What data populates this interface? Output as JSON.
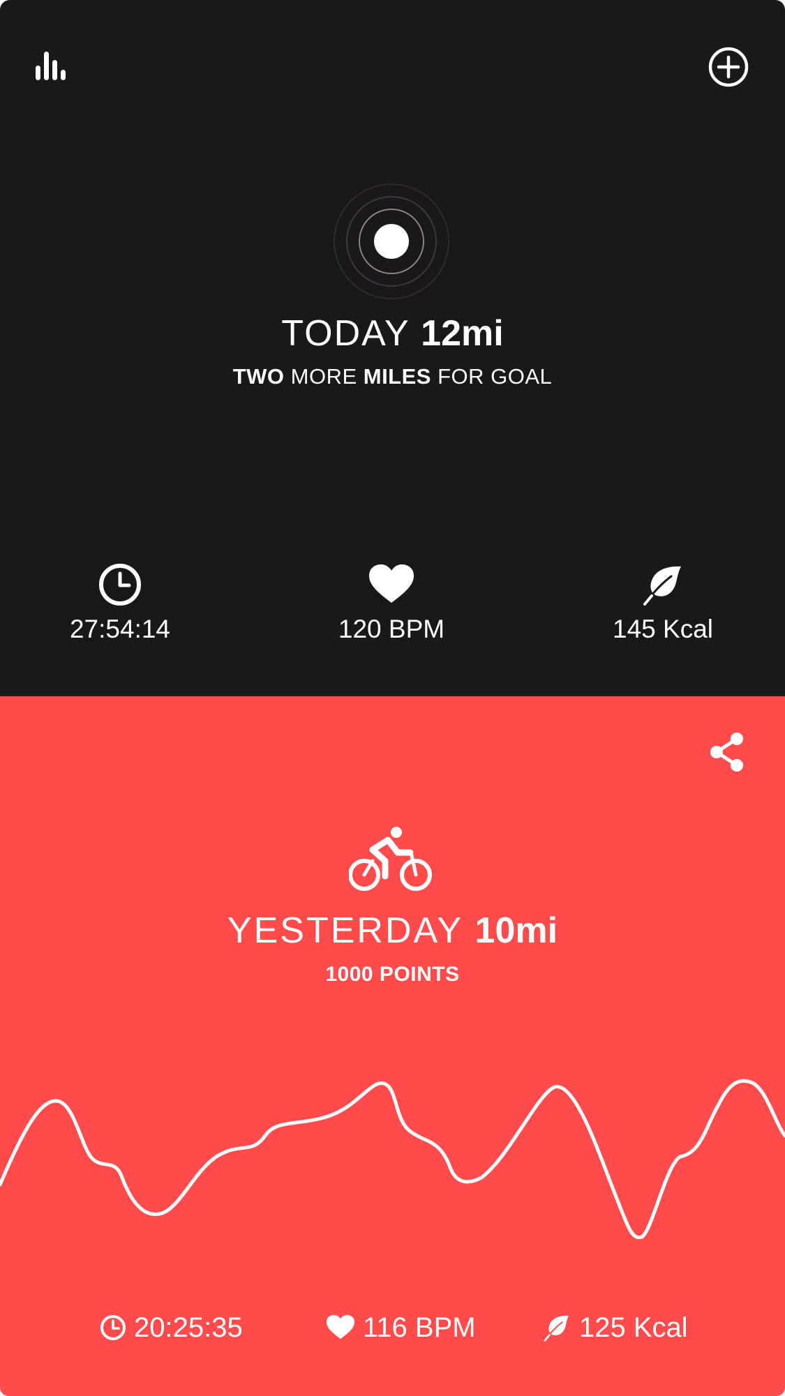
{
  "colors": {
    "dark_bg": "#1b181b",
    "accent_red": "#ff4b4b",
    "text": "#ffffff"
  },
  "header": {
    "stats_icon": "bar-chart-icon",
    "add_icon": "plus-circle-icon"
  },
  "today": {
    "label": "TODAY",
    "distance": "12mi",
    "goal_parts": [
      "TWO",
      " MORE ",
      "MILES",
      " FOR GOAL"
    ],
    "metrics": [
      {
        "icon": "clock-icon",
        "value": "27:54:14"
      },
      {
        "icon": "heart-icon",
        "value": "120 BPM"
      },
      {
        "icon": "leaf-icon",
        "value": "145 Kcal"
      }
    ]
  },
  "yesterday": {
    "share_icon": "share-icon",
    "activity_icon": "bicycle-icon",
    "label": "YESTERDAY",
    "distance": "10mi",
    "points": "1000 POINTS",
    "metrics": [
      {
        "icon": "clock-icon",
        "value": "20:25:35"
      },
      {
        "icon": "heart-icon",
        "value": "116 BPM"
      },
      {
        "icon": "leaf-icon",
        "value": "125 Kcal"
      }
    ]
  }
}
